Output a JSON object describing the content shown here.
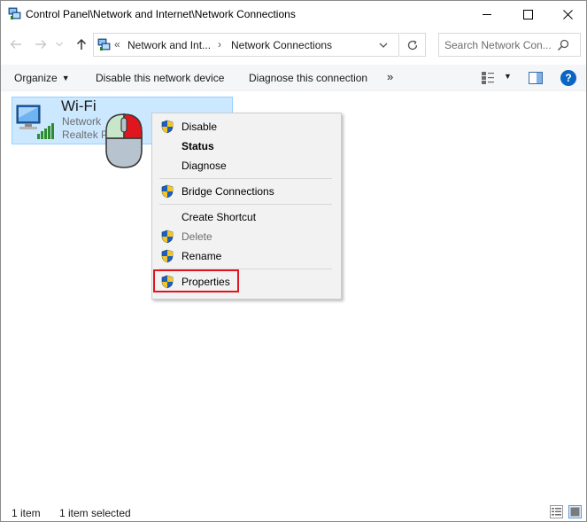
{
  "window": {
    "title": "Control Panel\\Network and Internet\\Network Connections"
  },
  "address": {
    "overflow": "«",
    "crumbs": [
      "Network and Int...",
      "Network Connections"
    ],
    "separator": "›"
  },
  "search": {
    "placeholder": "Search Network Con..."
  },
  "toolbar": {
    "organize": "Organize",
    "disable": "Disable this network device",
    "diagnose": "Diagnose this connection",
    "more": "»",
    "help": "?"
  },
  "connection": {
    "name": "Wi-Fi",
    "status": "Network",
    "adapter": "Realtek P"
  },
  "context_menu": {
    "items": [
      {
        "label": "Disable",
        "shield": true,
        "bold": false,
        "disabled": false
      },
      {
        "label": "Status",
        "shield": false,
        "bold": true,
        "disabled": false
      },
      {
        "label": "Diagnose",
        "shield": false,
        "bold": false,
        "disabled": false
      },
      {
        "label": "Bridge Connections",
        "shield": true,
        "bold": false,
        "disabled": false
      },
      {
        "label": "Create Shortcut",
        "shield": false,
        "bold": false,
        "disabled": false
      },
      {
        "label": "Delete",
        "shield": true,
        "bold": false,
        "disabled": true
      },
      {
        "label": "Rename",
        "shield": true,
        "bold": false,
        "disabled": false
      },
      {
        "label": "Properties",
        "shield": true,
        "bold": false,
        "disabled": false
      }
    ],
    "highlighted": "Properties",
    "highlight_color": "#e0161f"
  },
  "statusbar": {
    "count": "1 item",
    "selected": "1 item selected"
  },
  "colors": {
    "selection_fill": "#cce8ff",
    "selection_border": "#99d1ff",
    "mouse_right_button": "#e0161f",
    "mouse_left_button": "#c8e6c9"
  }
}
